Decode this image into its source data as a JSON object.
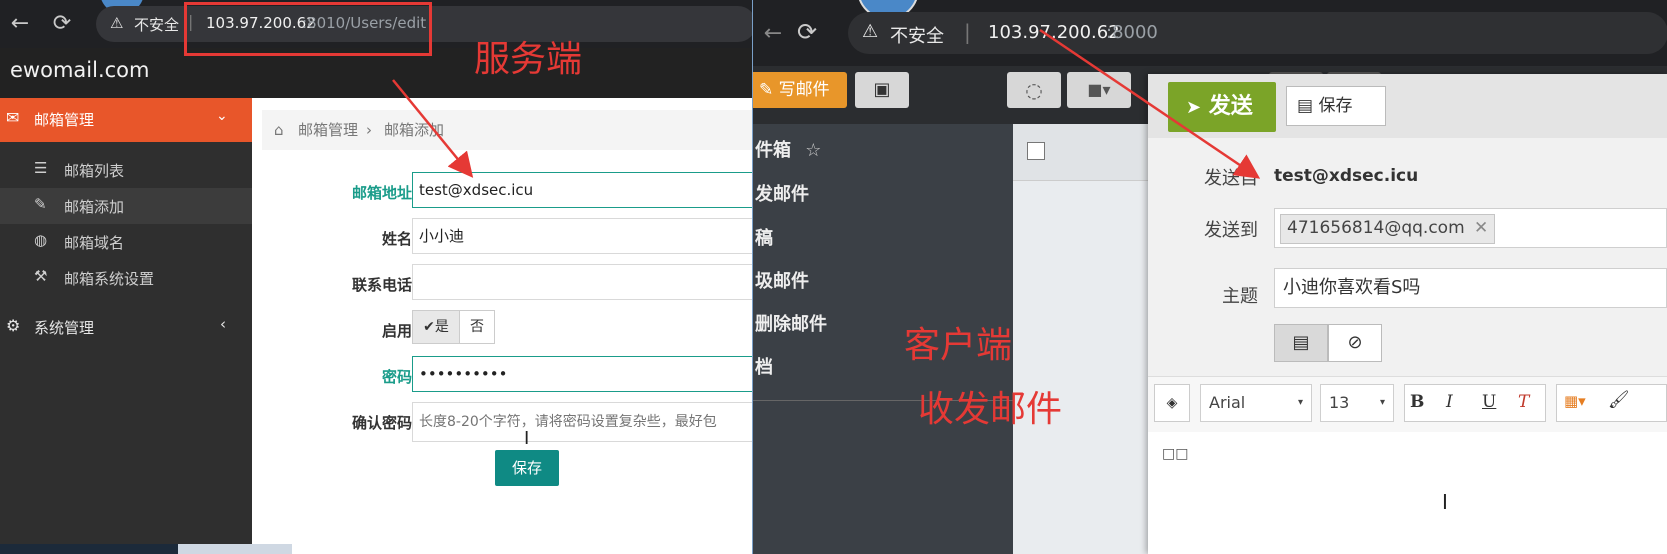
{
  "left_browser": {
    "back_icon": "arrow-left-icon",
    "reload_icon": "reload-icon",
    "security_text": "不安全",
    "url_host": "103.97.200.62",
    "url_rest": ":8010/Users/edit"
  },
  "left_app": {
    "brand": "ewomail.com",
    "sidebar": {
      "mailbox_manage": "邮箱管理",
      "items": [
        {
          "label": "邮箱列表",
          "icon": "list-icon"
        },
        {
          "label": "邮箱添加",
          "icon": "pencil-icon"
        },
        {
          "label": "邮箱域名",
          "icon": "globe-icon"
        },
        {
          "label": "邮箱系统设置",
          "icon": "wrench-icon"
        }
      ],
      "system_manage": "系统管理"
    },
    "breadcrumb": {
      "root": "邮箱管理",
      "sep": "›",
      "current": "邮箱添加"
    },
    "form": {
      "email_label": "邮箱地址",
      "email_value": "test@xdsec.icu",
      "name_label": "姓名",
      "name_value": "小小迪",
      "phone_label": "联系电话",
      "phone_value": "",
      "enable_label": "启用",
      "enable_yes": "✔是",
      "enable_no": "否",
      "password_label": "密码",
      "password_value": "••••••••••",
      "confirm_label": "确认密码",
      "confirm_placeholder": "长度8-20个字符，请将密码设置复杂些，最好包",
      "save": "保存"
    }
  },
  "right_browser": {
    "reload_icon": "reload-icon",
    "security_text": "不安全",
    "url_host": "103.97.200.62",
    "url_rest": ":8000"
  },
  "right_app": {
    "compose_btn": "写邮件",
    "folders": {
      "inbox": "件箱",
      "sent": "发邮件",
      "drafts": "稿",
      "junk": "圾邮件",
      "deleted": "删除邮件",
      "archive": "档"
    },
    "compose": {
      "send": "发送",
      "save": "保存",
      "from_label": "发送自",
      "from_value": "test@xdsec.icu",
      "to_label": "发送到",
      "to_value": "471656814@qq.com",
      "subject_label": "主题",
      "subject_value": "小迪你喜欢看S吗",
      "font_name": "Arial",
      "font_size": "13",
      "bold": "B",
      "italic": "I",
      "underline": "U",
      "clear": "T",
      "body": "□□"
    }
  },
  "annotations": {
    "server": "服务端",
    "client": "客户端",
    "send_receive": "收发邮件"
  },
  "colors": {
    "accent_orange": "#e8562a",
    "teal": "#1a9c8a",
    "send_green": "#7ba428",
    "annotation_red": "#e53935"
  }
}
